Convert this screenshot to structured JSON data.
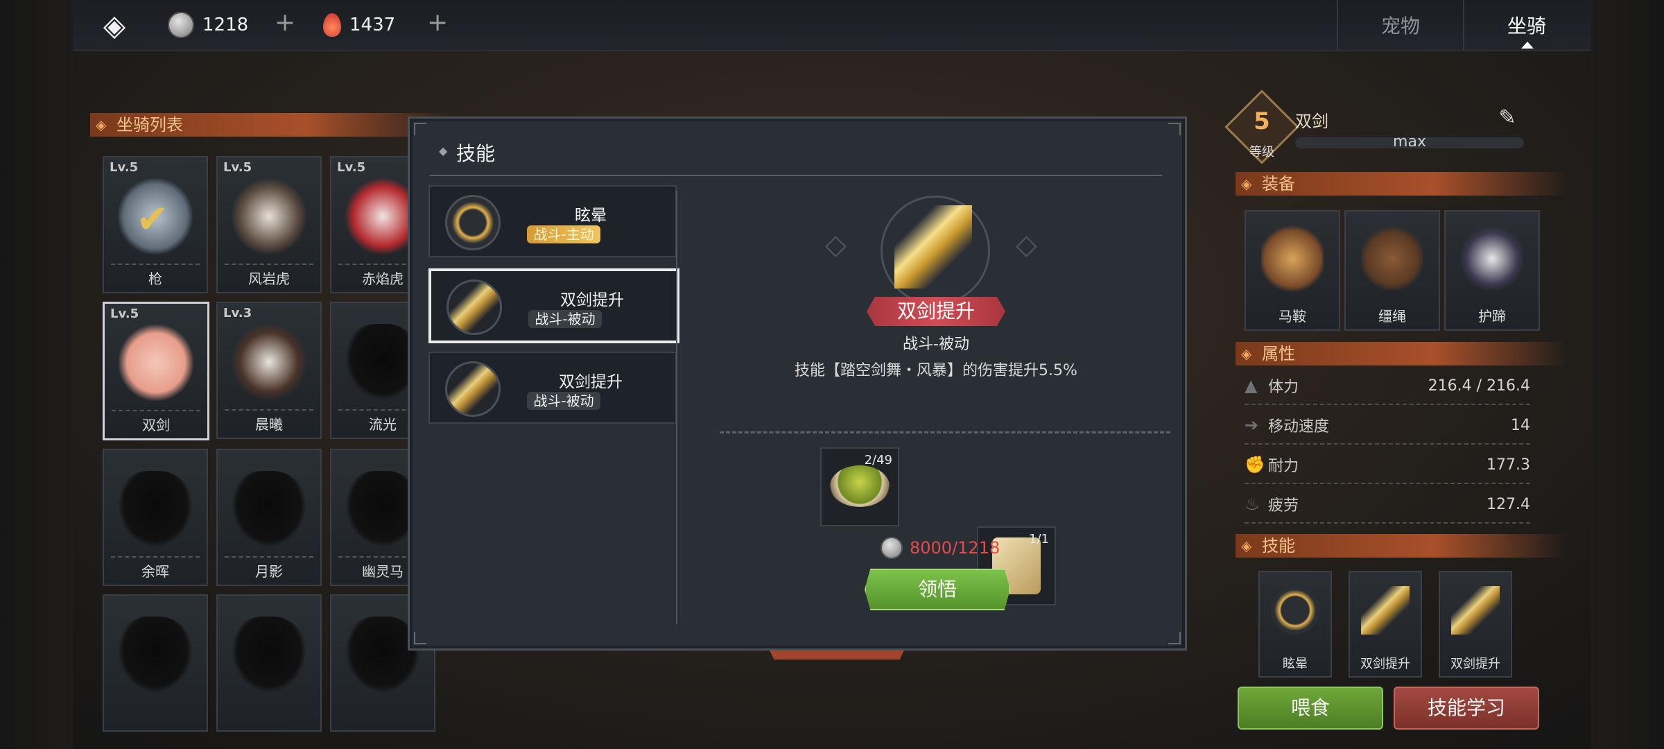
{
  "topbar": {
    "coins": "1218",
    "gems": "1437",
    "tabs": [
      {
        "label": "宠物"
      },
      {
        "label": "坐骑"
      }
    ],
    "active_tab": "坐骑"
  },
  "mount_list": {
    "title": "坐骑列表",
    "items": [
      {
        "lv": "Lv.5",
        "name": "枪"
      },
      {
        "lv": "Lv.5",
        "name": "风岩虎"
      },
      {
        "lv": "Lv.5",
        "name": "赤焰虎"
      },
      {
        "lv": "Lv.5",
        "name": "双剑"
      },
      {
        "lv": "Lv.3",
        "name": "晨曦"
      },
      {
        "lv": "",
        "name": "流光"
      },
      {
        "lv": "",
        "name": "余晖"
      },
      {
        "lv": "",
        "name": "月影"
      },
      {
        "lv": "",
        "name": "幽灵马"
      },
      {
        "lv": "",
        "name": ""
      },
      {
        "lv": "",
        "name": ""
      },
      {
        "lv": "",
        "name": ""
      }
    ]
  },
  "mount_detail": {
    "level": "5",
    "level_label": "等级",
    "name": "双剑",
    "exp_text": "max",
    "equip_title": "装备",
    "equip": [
      {
        "label": "马鞍"
      },
      {
        "label": "缰绳"
      },
      {
        "label": "护蹄"
      }
    ],
    "attr_title": "属性",
    "attrs": [
      {
        "name": "体力",
        "value": "216.4 / 216.4"
      },
      {
        "name": "移动速度",
        "value": "14"
      },
      {
        "name": "耐力",
        "value": "177.3"
      },
      {
        "name": "疲劳",
        "value": "127.4"
      }
    ],
    "skill_title": "技能",
    "skills": [
      {
        "label": "眩晕"
      },
      {
        "label": "双剑提升"
      },
      {
        "label": "双剑提升"
      }
    ],
    "feed_button": "喂食",
    "learn_button": "技能学习"
  },
  "skill_modal": {
    "title": "技能",
    "list": [
      {
        "name": "眩晕",
        "tag": "战斗-主动"
      },
      {
        "name": "双剑提升",
        "tag": "战斗-被动"
      },
      {
        "name": "双剑提升",
        "tag": "战斗-被动"
      }
    ],
    "selected": {
      "name": "双剑提升",
      "type": "战斗-被动",
      "desc": "技能【踏空剑舞・风暴】的伤害提升5.5%"
    },
    "materials": [
      {
        "count": "2/49"
      },
      {
        "count": "1/1"
      }
    ],
    "cost": "8000/1218",
    "realize_button": "领悟"
  },
  "colors": {
    "gold": "#f0b35a",
    "red_cost": "#e34c4c",
    "green_btn": "#6fa83a",
    "red_btn": "#a24a43"
  }
}
